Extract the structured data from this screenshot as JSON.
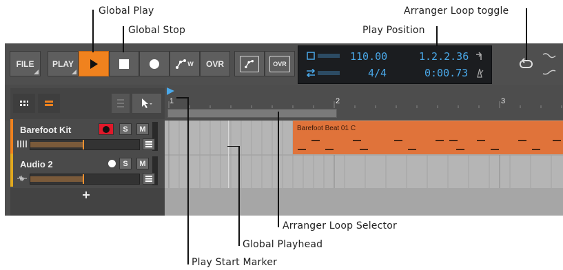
{
  "callouts": {
    "global_play": "Global Play",
    "global_stop": "Global Stop",
    "arranger_loop_toggle": "Arranger Loop toggle",
    "play_position": "Play Position",
    "arranger_loop_selector": "Arranger Loop Selector",
    "global_playhead": "Global Playhead",
    "play_start_marker": "Play Start Marker"
  },
  "transport": {
    "file_label": "FILE",
    "play_label": "PLAY",
    "ovr_label": "OVR",
    "automation_sub": "W",
    "ovr_small": "OVR",
    "tempo": "110.00",
    "time_signature": "4/4",
    "position_beats": "1.2.2.36",
    "position_time": "0:00.73"
  },
  "ruler": {
    "bar1": "1",
    "bar2": "2",
    "bar3": "3"
  },
  "tracks": [
    {
      "name": "Barefoot Kit",
      "solo": "S",
      "mute": "M"
    },
    {
      "name": "Audio 2",
      "solo": "S",
      "mute": "M"
    }
  ],
  "clip": {
    "name": "Barefoot Beat 01 C"
  },
  "colors": {
    "accent": "#f0821e",
    "display_text": "#4aa9ea",
    "record": "#e0192a",
    "clip": "#e0733a"
  }
}
